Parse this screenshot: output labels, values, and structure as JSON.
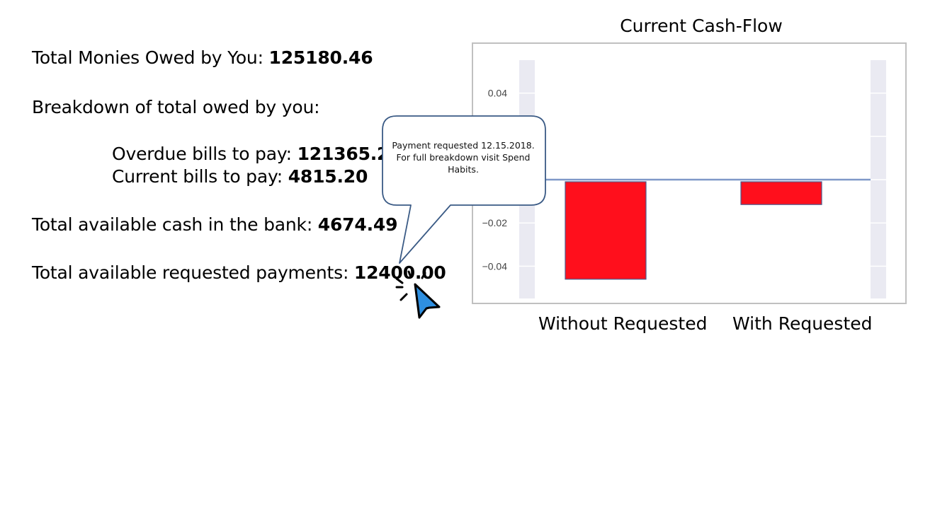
{
  "summary": {
    "owed_label": "Total Monies Owed by You: ",
    "owed_value": "125180.46",
    "breakdown_heading": "Breakdown of total owed by you:",
    "overdue_label": "Overdue bills to pay: ",
    "overdue_value": "121365.26",
    "current_label": "Current bills to pay: ",
    "current_value": "4815.20",
    "cash_label": "Total available cash in the bank: ",
    "cash_value": "4674.49",
    "requested_label": "Total available requested payments: ",
    "requested_value": "12400.00"
  },
  "tooltip": {
    "text": "Payment requested 12.15.2018. For full breakdown visit Spend Habits."
  },
  "chart_data": {
    "type": "bar",
    "title": "Current Cash-Flow",
    "categories": [
      "Without Requested",
      "With Requested"
    ],
    "values": [
      -0.046,
      -0.0115
    ],
    "ylim": [
      -0.055,
      0.055
    ],
    "yticks": [
      0.04,
      -0.02,
      -0.04
    ],
    "ytick_labels": [
      "0.04",
      "−0.02",
      "−0.04"
    ],
    "grid": true,
    "bar_color": "#ff0f1c",
    "zero_line_color": "#7f98c8",
    "background_band_color": "#eaeaf2"
  },
  "icons": {
    "cursor": "pointer-arrow-icon"
  }
}
